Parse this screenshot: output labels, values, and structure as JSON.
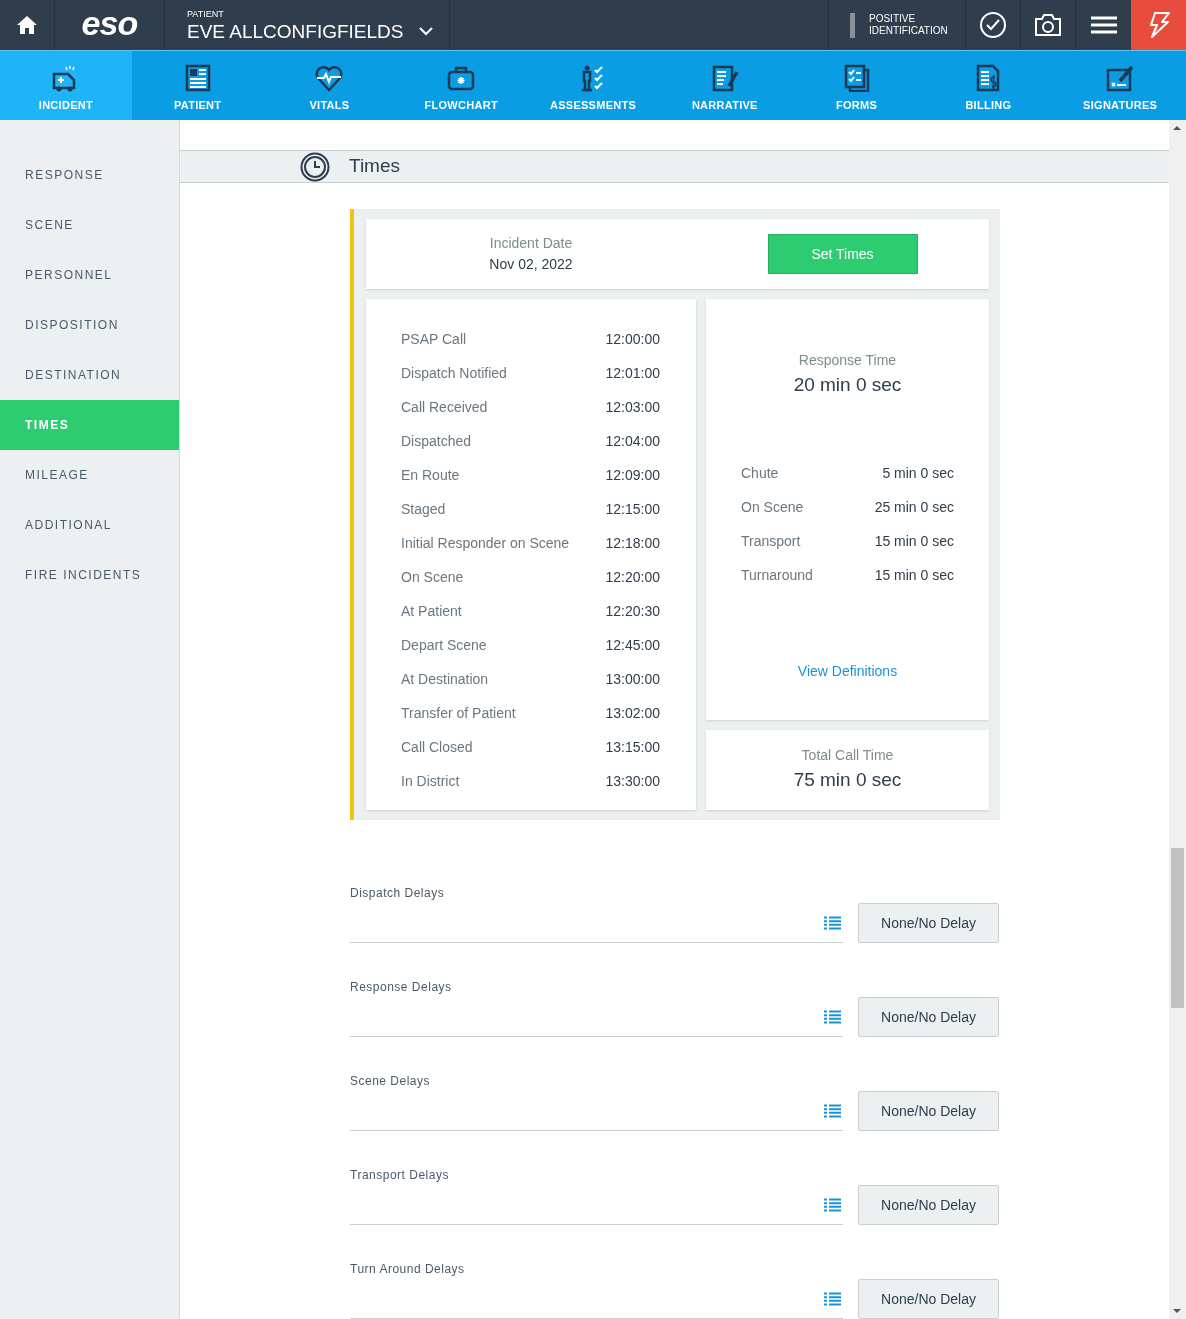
{
  "top_bar": {
    "logo": "eso",
    "patient_label": "PATIENT",
    "patient_name": "EVE ALLCONFIGFIELDS",
    "positive_identification": "POSITIVE IDENTIFICATION"
  },
  "tabs": [
    {
      "label": "INCIDENT",
      "selected": true
    },
    {
      "label": "PATIENT",
      "selected": false
    },
    {
      "label": "VITALS",
      "selected": false
    },
    {
      "label": "FLOWCHART",
      "selected": false
    },
    {
      "label": "ASSESSMENTS",
      "selected": false
    },
    {
      "label": "NARRATIVE",
      "selected": false
    },
    {
      "label": "FORMS",
      "selected": false
    },
    {
      "label": "BILLING",
      "selected": false
    },
    {
      "label": "SIGNATURES",
      "selected": false
    }
  ],
  "sidebar": {
    "items": [
      {
        "label": "RESPONSE",
        "selected": false
      },
      {
        "label": "SCENE",
        "selected": false
      },
      {
        "label": "PERSONNEL",
        "selected": false
      },
      {
        "label": "DISPOSITION",
        "selected": false
      },
      {
        "label": "DESTINATION",
        "selected": false
      },
      {
        "label": "TIMES",
        "selected": true
      },
      {
        "label": "MILEAGE",
        "selected": false
      },
      {
        "label": "ADDITIONAL",
        "selected": false
      },
      {
        "label": "FIRE INCIDENTS",
        "selected": false
      }
    ]
  },
  "section": {
    "title": "Times"
  },
  "incident_date": {
    "label": "Incident Date",
    "value": "Nov 02, 2022",
    "button": "Set Times"
  },
  "times": [
    {
      "label": "PSAP Call",
      "value": "12:00:00"
    },
    {
      "label": "Dispatch Notified",
      "value": "12:01:00"
    },
    {
      "label": "Call Received",
      "value": "12:03:00"
    },
    {
      "label": "Dispatched",
      "value": "12:04:00"
    },
    {
      "label": "En Route",
      "value": "12:09:00"
    },
    {
      "label": "Staged",
      "value": "12:15:00"
    },
    {
      "label": "Initial Responder on Scene",
      "value": "12:18:00"
    },
    {
      "label": "On Scene",
      "value": "12:20:00"
    },
    {
      "label": "At Patient",
      "value": "12:20:30"
    },
    {
      "label": "Depart Scene",
      "value": "12:45:00"
    },
    {
      "label": "At Destination",
      "value": "13:00:00"
    },
    {
      "label": "Transfer of Patient",
      "value": "13:02:00"
    },
    {
      "label": "Call Closed",
      "value": "13:15:00"
    },
    {
      "label": "In District",
      "value": "13:30:00"
    }
  ],
  "response_time": {
    "label": "Response Time",
    "value": "20 min 0 sec"
  },
  "intervals": [
    {
      "label": "Chute",
      "value": "5 min 0 sec"
    },
    {
      "label": "On Scene",
      "value": "25 min 0 sec"
    },
    {
      "label": "Transport",
      "value": "15 min 0 sec"
    },
    {
      "label": "Turnaround",
      "value": "15 min 0 sec"
    }
  ],
  "view_definitions": "View Definitions",
  "total_call_time": {
    "label": "Total Call Time",
    "value": "75 min 0 sec"
  },
  "delays": [
    {
      "label": "Dispatch Delays",
      "button": "None/No Delay"
    },
    {
      "label": "Response Delays",
      "button": "None/No Delay"
    },
    {
      "label": "Scene Delays",
      "button": "None/No Delay"
    },
    {
      "label": "Transport Delays",
      "button": "None/No Delay"
    },
    {
      "label": "Turn Around Delays",
      "button": "None/No Delay"
    }
  ]
}
